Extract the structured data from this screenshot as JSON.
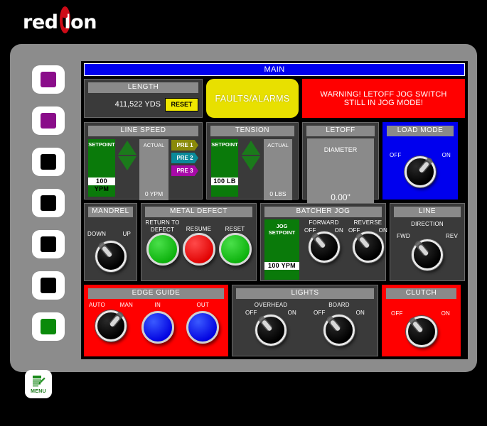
{
  "brand": {
    "text_red": "red",
    "text_l": "l",
    "text_on": "on",
    "logo_name": "red-lion-logo"
  },
  "device": {
    "menu_label": "MENU"
  },
  "function_keys": [
    {
      "name": "function-key-1",
      "color": "#8a0d8a"
    },
    {
      "name": "function-key-2",
      "color": "#8a0d8a"
    },
    {
      "name": "function-key-3",
      "color": "#000000"
    },
    {
      "name": "function-key-4",
      "color": "#000000"
    },
    {
      "name": "function-key-5",
      "color": "#000000"
    },
    {
      "name": "function-key-6",
      "color": "#000000"
    },
    {
      "name": "function-key-7",
      "color": "#0a8a0a"
    }
  ],
  "screen": {
    "title": "MAIN",
    "title_bg": "#0000ee",
    "length": {
      "header": "LENGTH",
      "value": "411,522 YDS",
      "reset_label": "RESET",
      "reset_color": "#f0e800"
    },
    "faults": {
      "label": "FAULTS/ALARMS",
      "color": "#e8e000"
    },
    "warning": {
      "line1": "WARNING! LETOFF JOG SWITCH",
      "line2": "STILL IN JOG MODE!",
      "color": "#ff0000"
    },
    "line_speed": {
      "header": "LINE SPEED",
      "setpoint_label": "SETPOINT",
      "setpoint_value": "100 YPM",
      "actual_label": "ACTUAL",
      "actual_value": "0 YPM",
      "up_icon": "triangle-up-icon",
      "down_icon": "triangle-down-icon",
      "presets": [
        {
          "label": "PRE 1",
          "color": "#8a8a0a"
        },
        {
          "label": "PRE 2",
          "color": "#0a8a9a"
        },
        {
          "label": "PRE 3",
          "color": "#a80aa8"
        }
      ]
    },
    "tension": {
      "header": "TENSION",
      "setpoint_label": "SETPOINT",
      "setpoint_value": "100 LB",
      "actual_label": "ACTUAL",
      "actual_value": "0 LBS"
    },
    "letoff": {
      "header": "LETOFF",
      "diameter_label": "DIAMETER",
      "diameter_value": "0.00\""
    },
    "load_mode": {
      "header": "LOAD MODE",
      "off": "OFF",
      "on": "ON",
      "position": "on"
    },
    "mandrel": {
      "header": "MANDREL",
      "left": "DOWN",
      "right": "UP",
      "position": "down"
    },
    "metal_defect": {
      "header": "METAL DEFECT",
      "buttons": [
        {
          "label_line1": "RETURN TO",
          "label_line2": "DEFECT",
          "color": "green"
        },
        {
          "label_line1": "RESUME",
          "label_line2": "",
          "color": "red"
        },
        {
          "label_line1": "RESET",
          "label_line2": "",
          "color": "green"
        }
      ]
    },
    "batcher_jog": {
      "header": "BATCHER JOG",
      "jog_setpoint_line1": "JOG",
      "jog_setpoint_line2": "SETPOINT",
      "jog_setpoint_value": "100 YPM",
      "forward": {
        "title": "FORWARD",
        "off": "OFF",
        "on": "ON",
        "position": "off"
      },
      "reverse": {
        "title": "REVERSE",
        "off": "OFF",
        "on": "ON",
        "position": "off"
      }
    },
    "line": {
      "header": "LINE",
      "title": "DIRECTION",
      "left": "FWD",
      "right": "REV",
      "position": "fwd"
    },
    "edge_guide": {
      "header": "EDGE GUIDE",
      "mode_left": "AUTO",
      "mode_right": "MAN",
      "mode_position": "man",
      "in_label": "IN",
      "out_label": "OUT"
    },
    "lights": {
      "header": "LIGHTS",
      "overhead": {
        "title": "OVERHEAD",
        "off": "OFF",
        "on": "ON",
        "position": "off"
      },
      "board": {
        "title": "BOARD",
        "off": "OFF",
        "on": "ON",
        "position": "off"
      }
    },
    "clutch": {
      "header": "CLUTCH",
      "off": "OFF",
      "on": "ON",
      "position": "off"
    }
  }
}
